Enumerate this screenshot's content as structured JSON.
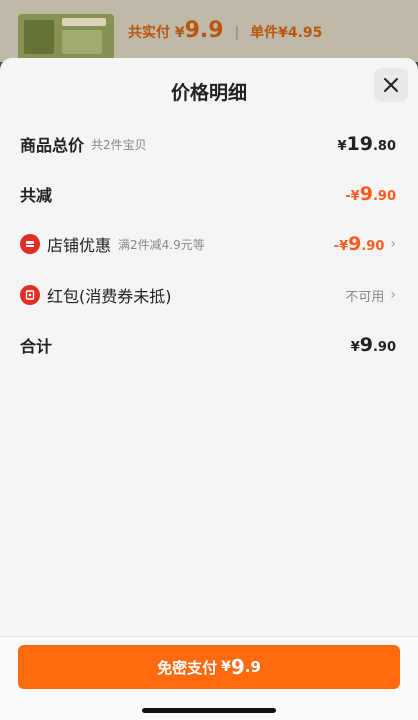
{
  "background": {
    "paid_label": "共实付",
    "paid_currency": "¥",
    "paid_amount": "9.9",
    "unit_label": "单件",
    "unit_price": "¥4.95"
  },
  "sheet": {
    "title": "价格明细",
    "close_icon": "close-icon"
  },
  "rows": {
    "total": {
      "label": "商品总价",
      "sub": "共2件宝贝",
      "currency": "¥",
      "int": "19",
      "dec": ".80"
    },
    "discount": {
      "label": "共减",
      "prefix": "-¥",
      "int": "9",
      "dec": ".90"
    },
    "shop": {
      "icon": "store-icon",
      "label": "店铺优惠",
      "sub": "满2件减4.9元等",
      "prefix": "-¥",
      "int": "9",
      "dec": ".90"
    },
    "redpacket": {
      "icon": "red-packet-icon",
      "label": "红包(消费券未抵)",
      "status": "不可用"
    },
    "sum": {
      "label": "合计",
      "currency": "¥",
      "int": "9",
      "dec": ".90"
    }
  },
  "footer": {
    "button_label": "免密支付",
    "currency": "¥",
    "int": "9",
    "dec": ".9"
  },
  "colors": {
    "accent": "#ff6a0f",
    "discount": "#ff5a1f",
    "icon_red": "#e02e24"
  }
}
